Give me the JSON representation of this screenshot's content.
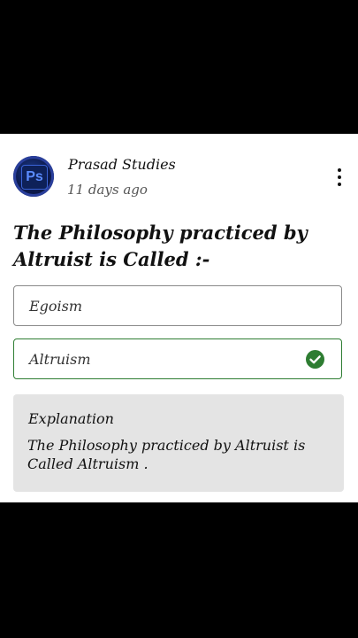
{
  "post": {
    "author": "Prasad Studies",
    "time_ago": "11 days ago",
    "avatar_text": "Ps",
    "menu_icon": "more-vert-icon"
  },
  "quiz": {
    "question": "The Philosophy practiced by Altruist is Called :-",
    "options": [
      {
        "label": "Egoism",
        "correct": false
      },
      {
        "label": "Altruism",
        "correct": true
      }
    ],
    "correct_color": "#2e7d32",
    "explanation": {
      "title": "Explanation",
      "text": "The Philosophy practiced by Altruist is Called Altruism ."
    }
  }
}
